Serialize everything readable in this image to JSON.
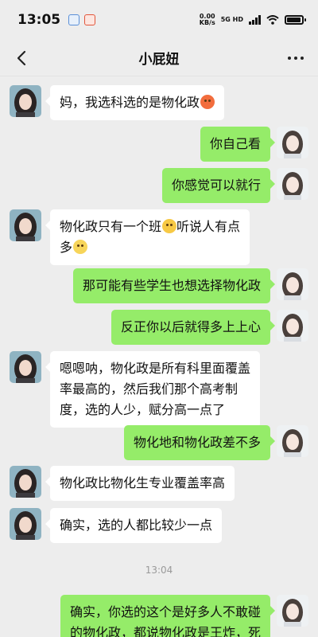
{
  "status_bar": {
    "time": "13:05",
    "net_speed_value": "0.00",
    "net_speed_unit": "KB/s",
    "net_type": "5G HD"
  },
  "nav": {
    "title": "小屁妞",
    "back_icon": "chevron-left-icon",
    "more_icon": "more-dots-icon"
  },
  "colors": {
    "background": "#ededed",
    "bubble_self": "#95ec69",
    "bubble_other": "#ffffff"
  },
  "messages": [
    {
      "sender": "other",
      "text": "妈，我选科选的是物化政",
      "emoji": "angry-face"
    },
    {
      "sender": "self",
      "text": "你自己看"
    },
    {
      "sender": "self",
      "text": "你感觉可以就行"
    },
    {
      "sender": "other",
      "text1": "物化政只有一个班",
      "emoji1": "facepalm-face",
      "text2": "听说人有点",
      "text3": "多",
      "emoji2": "worried-face"
    },
    {
      "sender": "self",
      "text": "那可能有些学生也想选择物化政"
    },
    {
      "sender": "self",
      "text": "反正你以后就得多上上心"
    },
    {
      "sender": "other",
      "lines": [
        "嗯嗯呐，物化政是所有科里面覆盖",
        "率最高的，然后我们那个高考制",
        "度，选的人少，赋分高一点了"
      ]
    },
    {
      "sender": "self",
      "text": "物化地和物化政差不多"
    },
    {
      "sender": "other",
      "text": "物化政比物化生专业覆盖率高"
    },
    {
      "sender": "other",
      "text": "确实，选的人都比较少一点"
    },
    {
      "sender": "self",
      "lines": [
        "确实，你选的这个是好多人不敢碰",
        "的物化政，都说物化政是王炸，死"
      ]
    }
  ],
  "timestamp": "13:04"
}
